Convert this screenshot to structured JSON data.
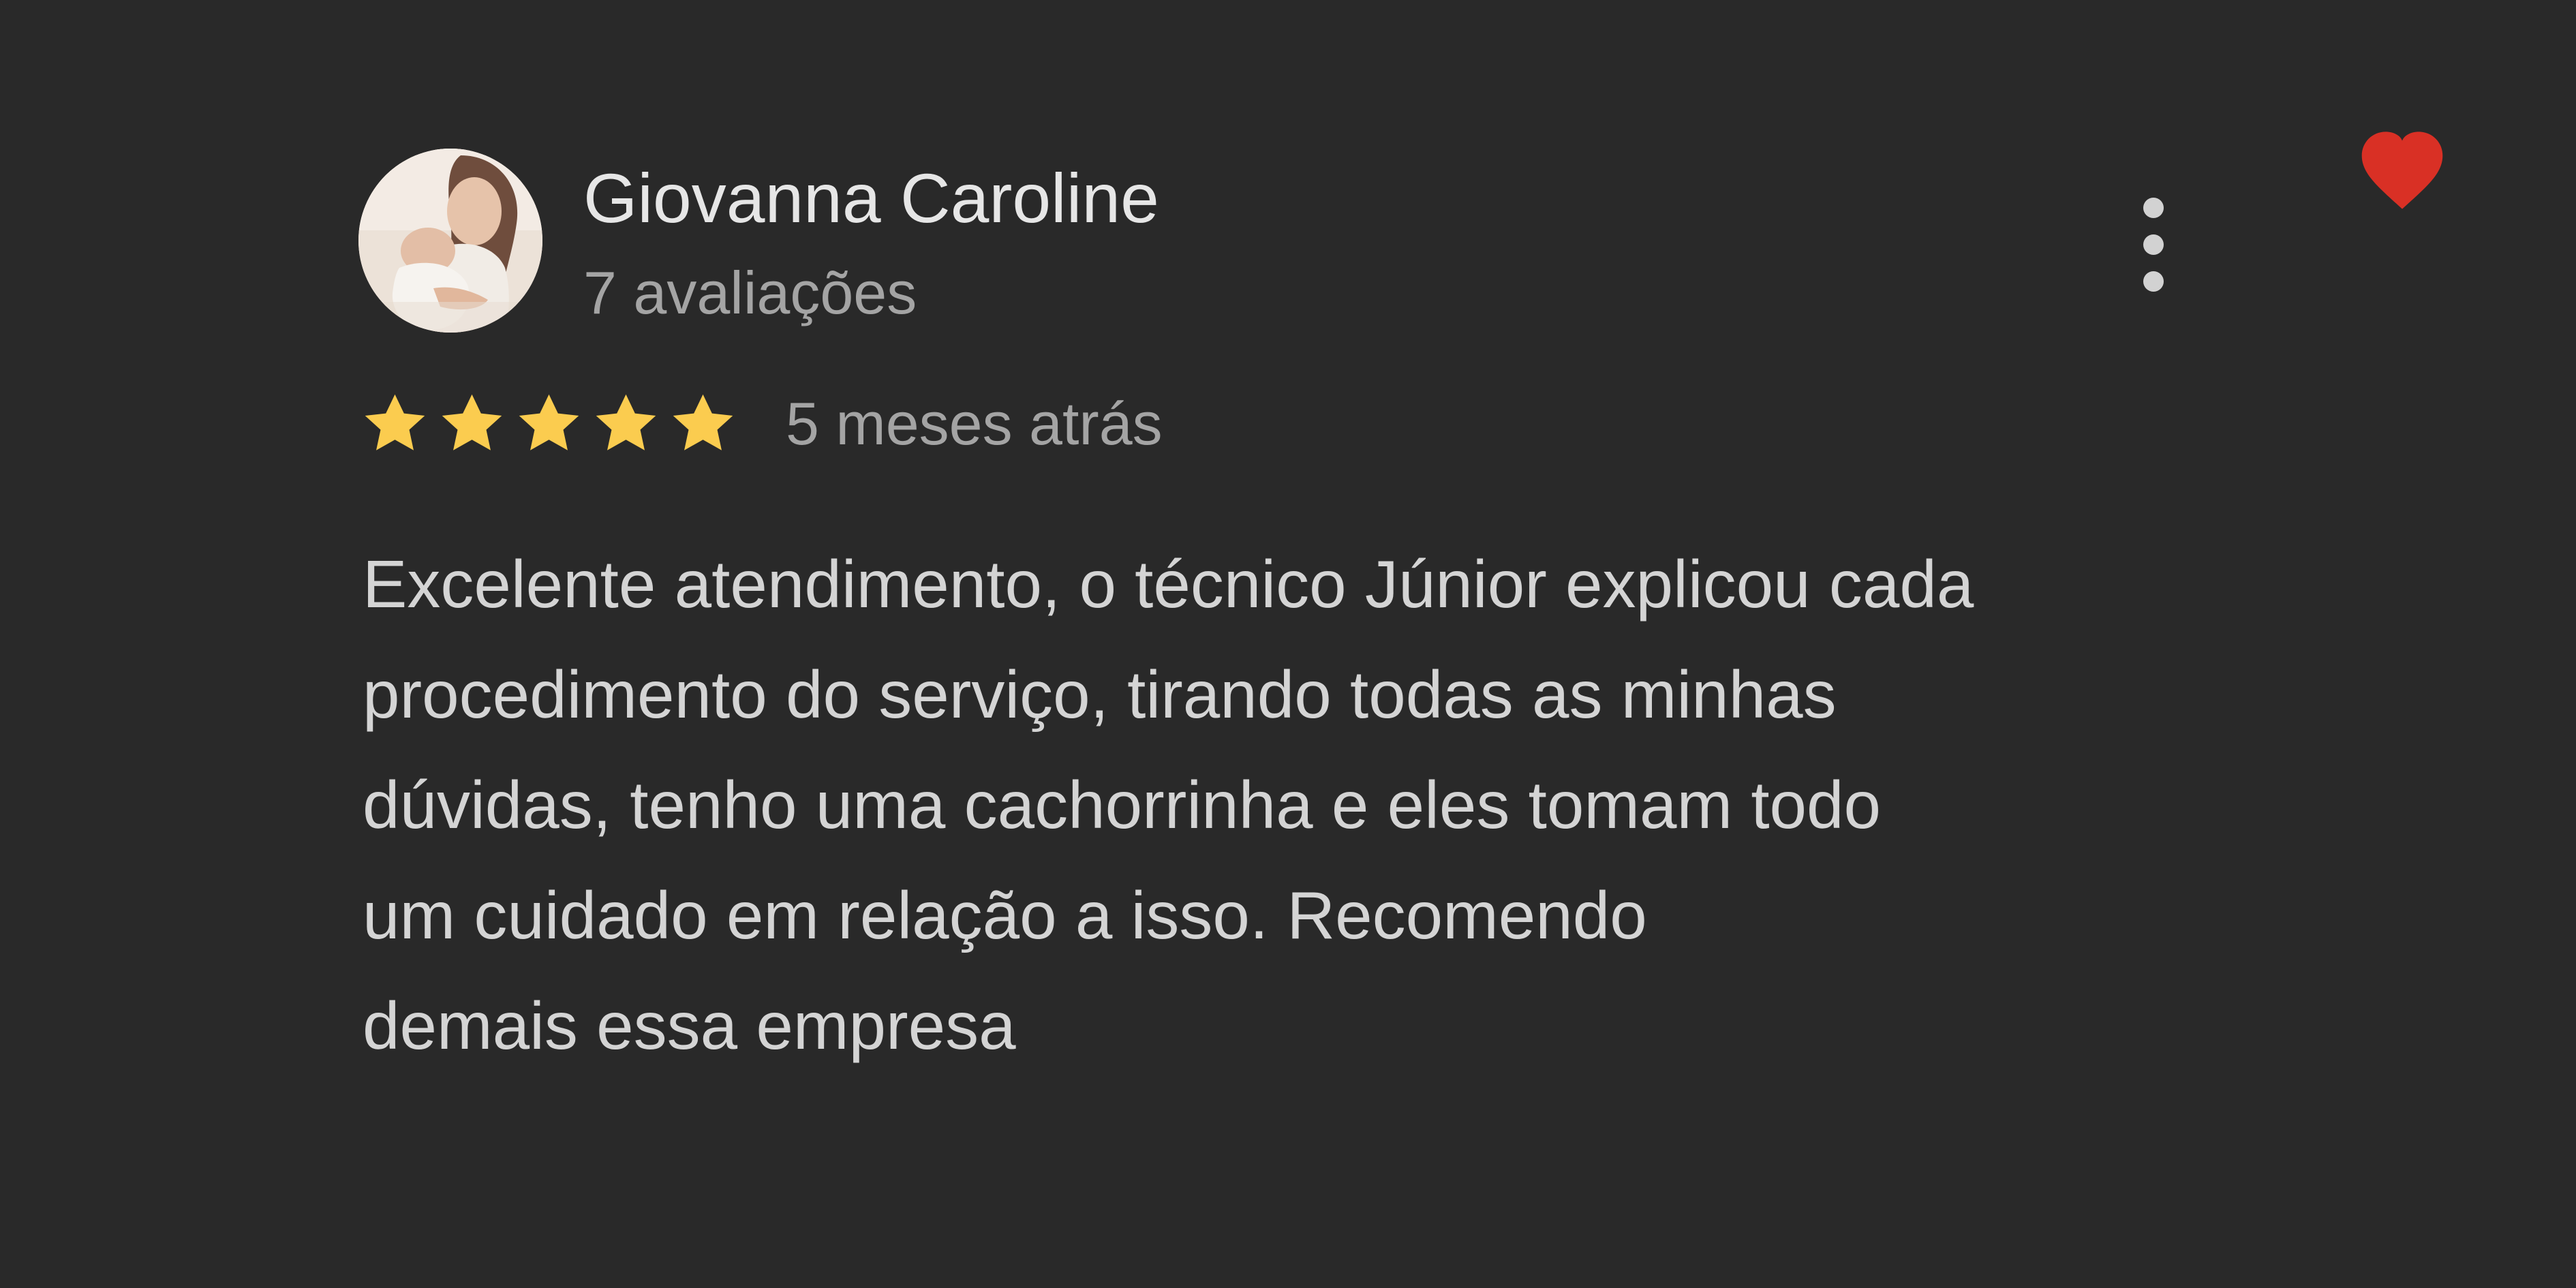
{
  "review": {
    "reviewer_name": "Giovanna Caroline",
    "review_count": "7 avaliações",
    "rating": 5,
    "rating_max": 5,
    "time": "5 meses atrás",
    "text_lines": [
      "Excelente atendimento, o técnico Júnior explicou cada",
      "procedimento do serviço, tirando todas as minhas",
      "dúvidas, tenho uma cachorrinha e eles tomam todo",
      "um cuidado em relação a isso. Recomendo",
      "demais essa empresa"
    ]
  },
  "icons": {
    "avatar": "profile-photo",
    "more": "more-vertical-icon",
    "heart": "heart-icon",
    "star": "star-icon"
  },
  "colors": {
    "background": "#292929",
    "name": "#e6e6e6",
    "secondary_text": "#a4a4a4",
    "body_text": "#d4d4d4",
    "star": "#fbcc4f",
    "heart": "#d93025",
    "more_dots": "#d2d2d2"
  }
}
